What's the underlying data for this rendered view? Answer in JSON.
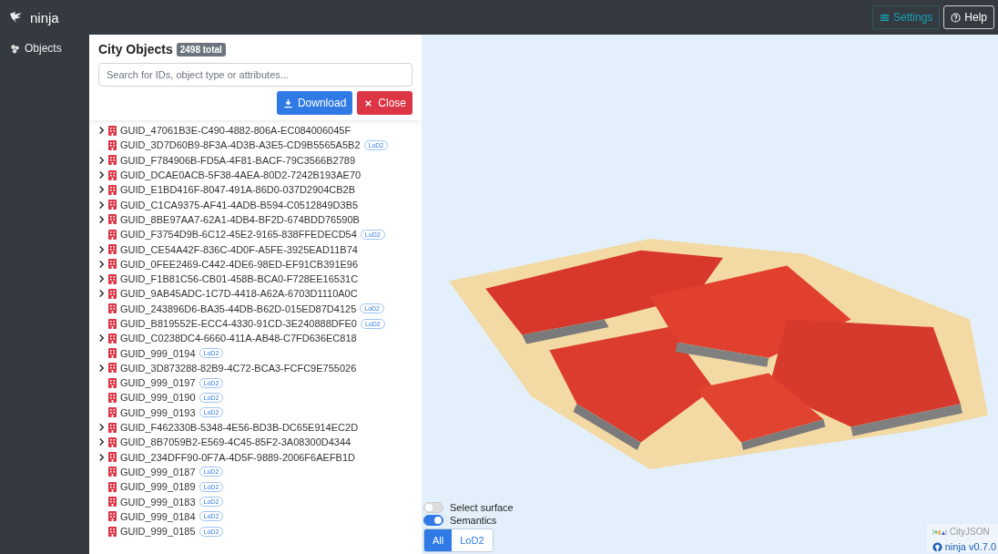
{
  "navbar": {
    "brand": "ninja",
    "buttons": [
      {
        "label": "Settings",
        "kind": "settings"
      },
      {
        "label": "Help",
        "kind": "help"
      }
    ]
  },
  "sidebar": {
    "items": [
      {
        "label": "Objects",
        "selected": true
      }
    ]
  },
  "panel": {
    "title": "City Objects",
    "count": "2498 total",
    "search": {
      "placeholder": "Search for IDs, object type or attributes..."
    },
    "buttons": [
      {
        "label": "Download",
        "kind": "download"
      },
      {
        "label": "Close",
        "kind": "close"
      }
    ],
    "objects": [
      {
        "id": "GUID_47061B3E-C490-4882-806A-EC084006045F",
        "expandable": true
      },
      {
        "id": "GUID_3D7D60B9-8F3A-4D3B-A3E5-CD9B5565A5B2",
        "expandable": false,
        "lod": "LoD2"
      },
      {
        "id": "GUID_F784906B-FD5A-4F81-BACF-79C3566B2789",
        "expandable": true
      },
      {
        "id": "GUID_DCAE0ACB-5F38-4AEA-80D2-7242B193AE70",
        "expandable": true
      },
      {
        "id": "GUID_E1BD416F-8047-491A-86D0-037D2904CB2B",
        "expandable": true
      },
      {
        "id": "GUID_C1CA9375-AF41-4ADB-B594-C0512849D3B5",
        "expandable": true
      },
      {
        "id": "GUID_8BE97AA7-62A1-4DB4-BF2D-674BDD76590B",
        "expandable": true
      },
      {
        "id": "GUID_F3754D9B-6C12-45E2-9165-838FFEDECD54",
        "expandable": false,
        "lod": "LoD2"
      },
      {
        "id": "GUID_CE54A42F-836C-4D0F-A5FE-3925EAD11B74",
        "expandable": true
      },
      {
        "id": "GUID_0FEE2469-C442-4DE6-98ED-EF91CB391E96",
        "expandable": true
      },
      {
        "id": "GUID_F1B81C56-CB01-458B-BCA0-F728EE16531C",
        "expandable": true
      },
      {
        "id": "GUID_9AB45ADC-1C7D-4418-A62A-6703D1110A0C",
        "expandable": true
      },
      {
        "id": "GUID_243896D6-BA35-44DB-B62D-015ED87D4125",
        "expandable": false,
        "lod": "LoD2"
      },
      {
        "id": "GUID_B819552E-ECC4-4330-91CD-3E240888DFE0",
        "expandable": false,
        "lod": "LoD2"
      },
      {
        "id": "GUID_C0238DC4-6660-411A-AB48-C7FD636EC818",
        "expandable": true
      },
      {
        "id": "GUID_999_0194",
        "expandable": false,
        "lod": "LoD2"
      },
      {
        "id": "GUID_3D873288-82B9-4C72-BCA3-FCFC9E755026",
        "expandable": true
      },
      {
        "id": "GUID_999_0197",
        "expandable": false,
        "lod": "LoD2"
      },
      {
        "id": "GUID_999_0190",
        "expandable": false,
        "lod": "LoD2"
      },
      {
        "id": "GUID_999_0193",
        "expandable": false,
        "lod": "LoD2"
      },
      {
        "id": "GUID_F462330B-5348-4E56-BD3B-DC65E914EC2D",
        "expandable": true
      },
      {
        "id": "GUID_8B7059B2-E569-4C45-85F2-3A08300D4344",
        "expandable": true
      },
      {
        "id": "GUID_234DFF90-0F7A-4D5F-9889-2006F6AEFB1D",
        "expandable": true
      },
      {
        "id": "GUID_999_0187",
        "expandable": false,
        "lod": "LoD2"
      },
      {
        "id": "GUID_999_0189",
        "expandable": false,
        "lod": "LoD2"
      },
      {
        "id": "GUID_999_0183",
        "expandable": false,
        "lod": "LoD2"
      },
      {
        "id": "GUID_999_0184",
        "expandable": false,
        "lod": "LoD2"
      },
      {
        "id": "GUID_999_0185",
        "expandable": false,
        "lod": "LoD2"
      }
    ]
  },
  "viewer": {
    "toggles": [
      {
        "label": "Select surface",
        "on": false
      },
      {
        "label": "Semantics",
        "on": true
      }
    ],
    "lod_buttons": [
      {
        "label": "All",
        "selected": true
      },
      {
        "label": "LoD2",
        "selected": false
      }
    ],
    "footer": {
      "logo": "CityJSON",
      "version": "ninja v0.7.0"
    }
  }
}
